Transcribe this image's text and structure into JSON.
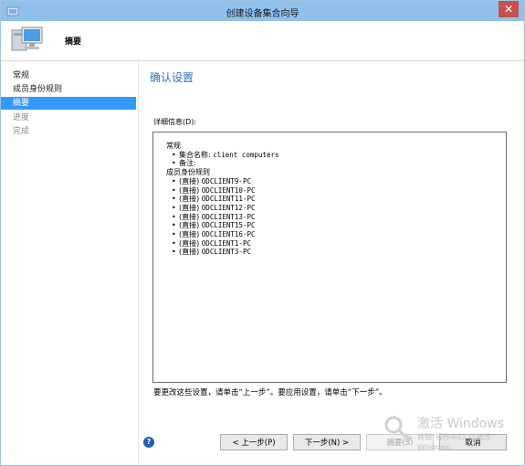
{
  "window": {
    "title": "创建设备集合向导",
    "close_glyph": "✕"
  },
  "header": {
    "title": "摘要"
  },
  "nav": {
    "items": [
      {
        "label": "常规",
        "state": "normal"
      },
      {
        "label": "成员身份规则",
        "state": "normal"
      },
      {
        "label": "摘要",
        "state": "selected"
      },
      {
        "label": "进度",
        "state": "disabled"
      },
      {
        "label": "完成",
        "state": "disabled"
      }
    ]
  },
  "main": {
    "page_title": "确认设置",
    "details_label": "详细信息(D):",
    "details": {
      "general_heading": "常规",
      "collection_name_label": "集合名称:",
      "collection_name_value": "client computers",
      "comment_label": "备注:",
      "rules_heading": "成员身份规则",
      "rule_prefix": "(直接)",
      "rules": [
        "ODCLIENT9-PC",
        "ODCLIENT10-PC",
        "ODCLIENT11-PC",
        "ODCLIENT12-PC",
        "ODCLIENT13-PC",
        "ODCLIENT15-PC",
        "ODCLIENT16-PC",
        "ODCLIENT1-PC",
        "ODCLIENT3-PC"
      ]
    },
    "hint": "要更改这些设置，请单击“上一步”。要应用设置，请单击“下一步”。"
  },
  "footer": {
    "help_glyph": "?",
    "prev_label": "< 上一步(P)",
    "next_label": "下一步(N) >",
    "summary_label": "摘要(S)",
    "cancel_label": "取消"
  },
  "watermark": {
    "main": "激活 Windows",
    "sub": "转到“操作中心”以激活 Windows。"
  },
  "colors": {
    "titlebar": "#8fc1ec",
    "selected": "#3399ff",
    "page_title": "#2c73c7",
    "close": "#c7514c"
  }
}
